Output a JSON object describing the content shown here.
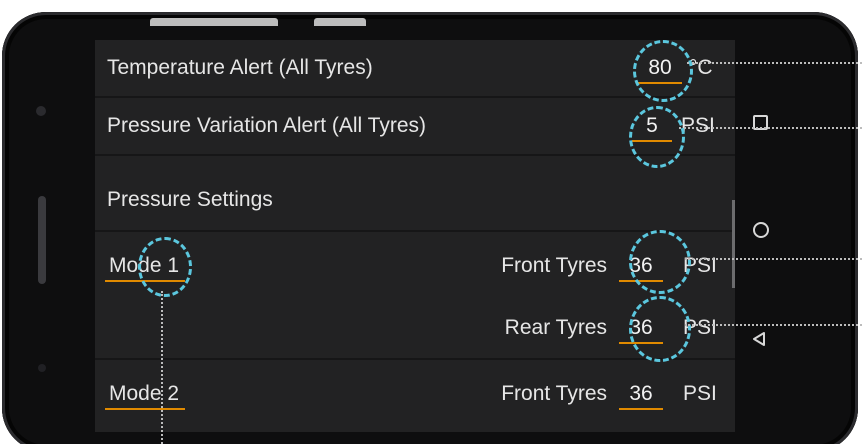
{
  "settings": {
    "temperature_alert": {
      "label": "Temperature Alert (All Tyres)",
      "value": "80",
      "unit": "°C"
    },
    "pressure_variation_alert": {
      "label": "Pressure Variation Alert (All Tyres)",
      "value": "5",
      "unit": "PSI"
    },
    "pressure_settings_header": "Pressure Settings",
    "modes": [
      {
        "name": "Mode 1",
        "front": {
          "label": "Front Tyres",
          "value": "36",
          "unit": "PSI"
        },
        "rear": {
          "label": "Rear Tyres",
          "value": "36",
          "unit": "PSI"
        }
      },
      {
        "name": "Mode 2",
        "front": {
          "label": "Front Tyres",
          "value": "36",
          "unit": "PSI"
        }
      }
    ]
  },
  "colors": {
    "screen_bg": "#222223",
    "underline_accent": "#e08a00",
    "highlight": "#5bc7de"
  },
  "nav_icons": [
    "recents-square-icon",
    "home-circle-icon",
    "back-triangle-icon"
  ]
}
